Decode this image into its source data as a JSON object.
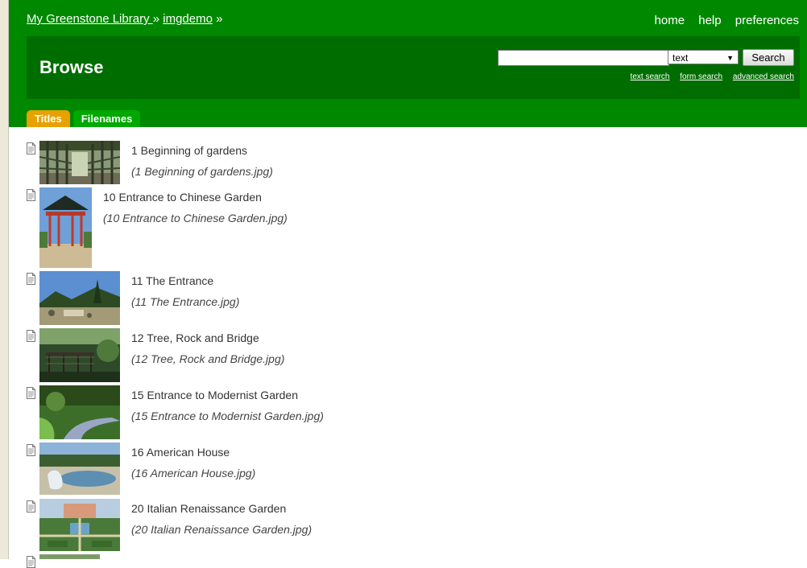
{
  "breadcrumb": {
    "library": "My Greenstone Library ",
    "sep1": "»",
    "collection": "imgdemo",
    "sep2": "»"
  },
  "top_nav": [
    "home",
    "help",
    "preferences"
  ],
  "page_title": "Browse",
  "search": {
    "value": "",
    "type_selected": "text",
    "button": "Search",
    "links": [
      "text search",
      "form search",
      "advanced search"
    ]
  },
  "tabs": [
    {
      "label": "Titles",
      "active": true
    },
    {
      "label": "Filenames",
      "active": false
    }
  ],
  "items": [
    {
      "title": "1 Beginning of gardens",
      "file": "(1 Beginning of gardens.jpg)",
      "thumb": "pergola-icon"
    },
    {
      "title": "10 Entrance to Chinese Garden",
      "file": "(10 Entrance to Chinese Garden.jpg)",
      "thumb": "pavilion-icon"
    },
    {
      "title": "11 The Entrance",
      "file": "(11 The Entrance.jpg)",
      "thumb": "landscape-icon"
    },
    {
      "title": "12 Tree, Rock and Bridge",
      "file": "(12 Tree, Rock and Bridge.jpg)",
      "thumb": "bridge-icon"
    },
    {
      "title": "15 Entrance to Modernist Garden",
      "file": "(15 Entrance to Modernist Garden.jpg)",
      "thumb": "path-icon"
    },
    {
      "title": "16 American House",
      "file": "(16 American House.jpg)",
      "thumb": "pool-icon"
    },
    {
      "title": "20 Italian Renaissance Garden",
      "file": "(20 Italian Renaissance Garden.jpg)",
      "thumb": "formal-garden-icon"
    }
  ],
  "colors": {
    "header_green": "#008800",
    "banner_green": "#006d00",
    "tab_active": "#e7a100",
    "tab_inactive": "#00a800"
  }
}
